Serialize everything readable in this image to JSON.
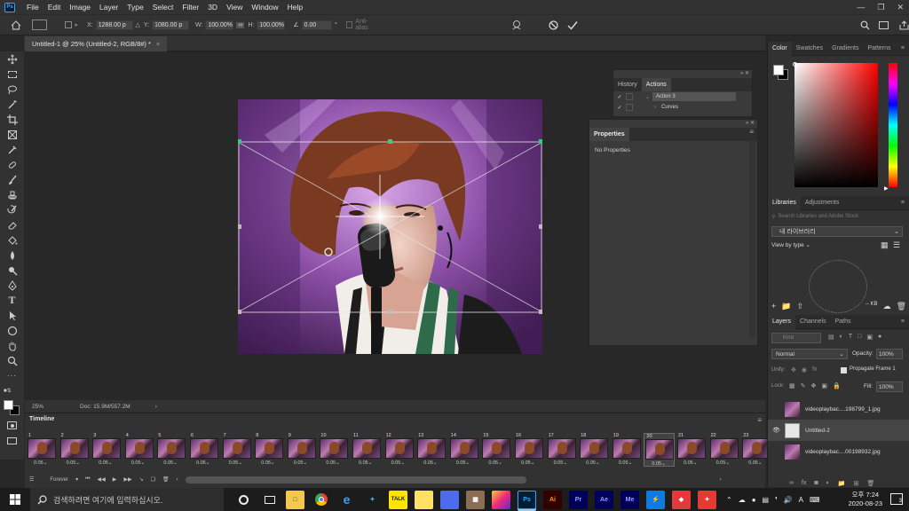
{
  "menu": {
    "logo": "Ps",
    "items": [
      "File",
      "Edit",
      "Image",
      "Layer",
      "Type",
      "Select",
      "Filter",
      "3D",
      "View",
      "Window",
      "Help"
    ]
  },
  "options": {
    "x_label": "X:",
    "x_value": "1288.00 p",
    "y_label": "Y:",
    "y_value": "1080.00 p",
    "w_label": "W:",
    "w_value": "100.00%",
    "h_label": "H:",
    "h_value": "100.00%",
    "angle_value": "0.00",
    "degree": "°",
    "antialias": "Anti-alias"
  },
  "document": {
    "tab_title": "Untitled-1 @ 25% (Untitled-2, RGB/8#) *",
    "close": "×",
    "zoom": "25%",
    "doc_info": "Doc: 15.9M/557.2M"
  },
  "timeline": {
    "title": "Timeline",
    "frames": [
      {
        "n": "1",
        "d": "0.05"
      },
      {
        "n": "2",
        "d": "0.05"
      },
      {
        "n": "3",
        "d": "0.05"
      },
      {
        "n": "4",
        "d": "0.05"
      },
      {
        "n": "5",
        "d": "0.05"
      },
      {
        "n": "6",
        "d": "0.05"
      },
      {
        "n": "7",
        "d": "0.05"
      },
      {
        "n": "8",
        "d": "0.05"
      },
      {
        "n": "9",
        "d": "0.05"
      },
      {
        "n": "10",
        "d": "0.05"
      },
      {
        "n": "11",
        "d": "0.05"
      },
      {
        "n": "12",
        "d": "0.05"
      },
      {
        "n": "13",
        "d": "0.05"
      },
      {
        "n": "14",
        "d": "0.05"
      },
      {
        "n": "15",
        "d": "0.05"
      },
      {
        "n": "16",
        "d": "0.05"
      },
      {
        "n": "17",
        "d": "0.05"
      },
      {
        "n": "18",
        "d": "0.05"
      },
      {
        "n": "19",
        "d": "0.05"
      },
      {
        "n": "20",
        "d": "0.05"
      },
      {
        "n": "21",
        "d": "0.05"
      },
      {
        "n": "22",
        "d": "0.05"
      },
      {
        "n": "23",
        "d": "0.05"
      }
    ],
    "selected_frame": "20",
    "loop": "Forever"
  },
  "history": {
    "tabs": [
      "History",
      "Actions"
    ],
    "active_tab": "Actions",
    "rows": [
      "Action 3",
      "Curves"
    ]
  },
  "properties": {
    "title": "Properties",
    "empty": "No Properties"
  },
  "color": {
    "tabs": [
      "Color",
      "Swatches",
      "Gradients",
      "Patterns"
    ],
    "fg": "#ffffff",
    "bg": "#000000",
    "hue": "#ff0000"
  },
  "libraries": {
    "tabs": [
      "Libraries",
      "Adjustments"
    ],
    "search_placeholder": "Search Libraries and Adobe Stock",
    "library_name": "내 라이브러리",
    "view_by": "View by type",
    "size": "-- KB"
  },
  "layers": {
    "tabs": [
      "Layers",
      "Channels",
      "Paths"
    ],
    "kind": "Kind",
    "blend_mode": "Normal",
    "opacity_label": "Opacity:",
    "opacity": "100%",
    "unify_label": "Unify:",
    "propagate": "Propagate Frame 1",
    "lock_label": "Lock:",
    "fill_label": "Fill:",
    "fill": "100%",
    "items": [
      {
        "name": "videoplaybac....198799_1.jpg",
        "visible": false
      },
      {
        "name": "Untitled-2",
        "visible": true
      },
      {
        "name": "videoplaybac....00198932.jpg",
        "visible": false
      }
    ]
  },
  "taskbar": {
    "search_placeholder": "검색하려면 여기에 입력하십시오.",
    "apps": [
      "Ai",
      "Pr",
      "Ae",
      "Me"
    ],
    "ime": "A",
    "time": "오후 7:24",
    "date": "2020-08-23",
    "notif_count": "3"
  }
}
